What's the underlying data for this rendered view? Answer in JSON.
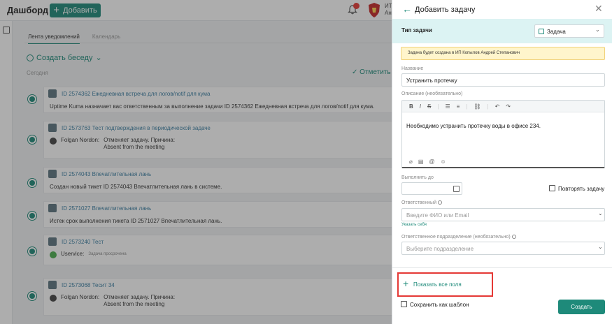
{
  "header": {
    "title": "Дашборд",
    "add_label": "Добавить",
    "user_line1": "ИТ",
    "user_line2": "Ан"
  },
  "feed": {
    "tabs": [
      "Лента уведомлений",
      "Календарь"
    ],
    "create_chat": "Создать беседу",
    "today": "Сегодня",
    "mark_all": "Отметить",
    "cards": [
      {
        "title": "ID 2574362 Ежедневная встреча для логов/notif для кума",
        "body": "Uptime Kuma назначает вас ответственным за выполнение задачи ID 2574362 Ежедневная встреча для логов/notif для кума."
      },
      {
        "title": "ID 2573763 Тест подтверждения в периодической задаче",
        "author": "Folgan Nordon:",
        "text1": "Отменяет задачу. Причина:",
        "text2": "Absent from the meeting"
      },
      {
        "title": "ID 2574043 Впечатлительная лань",
        "body": "Создан новый тикет ID 2574043 Впечатлительная лань в системе."
      },
      {
        "title": "ID 2571027 Впечатлительная лань",
        "body": "Истек срок выполнения тикета ID 2571027 Впечатлительная лань."
      },
      {
        "title": "ID 2573240 Тест",
        "author": "Uservice:",
        "text1": "Задача просрочена"
      },
      {
        "title": "ID 2573068 Тесит 34",
        "author": "Folgan Nordon:",
        "text1": "Отменяет задачу. Причина:",
        "text2": "Absent from the meeting"
      }
    ]
  },
  "panel": {
    "title": "Добавить задачу",
    "task_type_label": "Тип задачи",
    "task_type_value": "Задача",
    "notice": "Задача будет создана в ИП Копылов Андрей Степанович",
    "name_label": "Название",
    "name_value": "Устранить протечку",
    "description_label": "Описание (необязательно)",
    "description_value": "Необходимо устранить протечку воды в офисе 234.",
    "due_label": "Выполнить до",
    "repeat_label": "Повторять задачу",
    "responsible_label": "Ответственный",
    "responsible_placeholder": "Введите ФИО или Email",
    "assign_self": "Указать себя",
    "department_label": "Ответственное подразделение (необязательно)",
    "department_placeholder": "Выберите подразделение",
    "show_all_fields": "Показать все поля",
    "save_template": "Сохранить как шаблон",
    "create": "Создать"
  },
  "colors": {
    "accent": "#1e8a7a",
    "highlight": "#e53935",
    "notice_bg": "#fff5cc",
    "type_row_bg": "#dcf3f3"
  }
}
